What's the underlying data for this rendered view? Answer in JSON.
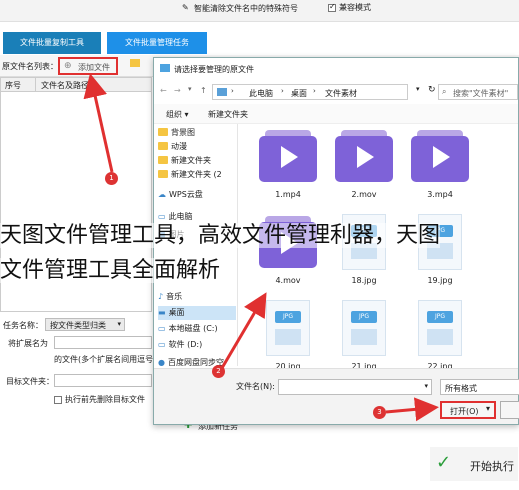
{
  "app": {
    "top_hint": "智能清除文件名中的特殊符号",
    "compat_label": "兼容模式",
    "tabs": [
      "文件批量复制工具",
      "文件批量管理任务"
    ],
    "file_list_label": "原文件名列表：",
    "add_file_button": "添加文件",
    "table_headers": [
      "序号",
      "文件名及路径"
    ],
    "task_name_label": "任务名称：",
    "task_name_value": "按文件类型归类",
    "ext_label": "将扩展名为",
    "ext_hint": "的文件(多个扩展名间用逗号",
    "target_folder_label": "目标文件夹：",
    "clear_before_label": "执行前先删除目标文件",
    "add_task_button": "添加新任务",
    "start_button": "开始执行"
  },
  "dialog": {
    "title": "请选择要管理的原文件",
    "breadcrumb": [
      "此电脑",
      "桌面",
      "文件素材"
    ],
    "search_placeholder": "搜索\"文件素材\"",
    "organize_label": "组织",
    "new_folder_label": "新建文件夹",
    "nav_items": [
      {
        "label": "背景图",
        "icon": "folder-icon"
      },
      {
        "label": "动漫",
        "icon": "folder-icon"
      },
      {
        "label": "新建文件夹",
        "icon": "folder-icon"
      },
      {
        "label": "新建文件夹 (2",
        "icon": "folder-icon"
      },
      {
        "label": "WPS云盘",
        "icon": "cloud-icon"
      },
      {
        "label": "此电脑",
        "icon": "computer-icon"
      },
      {
        "label": "图片",
        "icon": "image-icon"
      },
      {
        "label": "音乐",
        "icon": "music-icon"
      },
      {
        "label": "桌面",
        "icon": "desktop-icon"
      },
      {
        "label": "本地磁盘 (C:)",
        "icon": "drive-icon"
      },
      {
        "label": "软件 (D:)",
        "icon": "drive-icon"
      },
      {
        "label": "百度网盘同步空",
        "icon": "baidu-icon"
      }
    ],
    "files": [
      {
        "name": "1.mp4",
        "type": "video"
      },
      {
        "name": "2.mov",
        "type": "video"
      },
      {
        "name": "3.mp4",
        "type": "video"
      },
      {
        "name": "4.mov",
        "type": "video"
      },
      {
        "name": "18.jpg",
        "type": "image"
      },
      {
        "name": "19.jpg",
        "type": "image"
      },
      {
        "name": "20.jpg",
        "type": "image"
      },
      {
        "name": "21.jpg",
        "type": "image"
      },
      {
        "name": "22.jpg",
        "type": "image"
      }
    ],
    "filename_label": "文件名(N):",
    "filetype_value": "所有格式",
    "open_button": "打开(O)",
    "jpg_tag": "JPG"
  },
  "annotations": [
    "1",
    "2",
    "3"
  ],
  "headline": {
    "line1": "天图文件管理工具，高效文件管理利器，天图",
    "line2": "文件管理工具全面解析"
  },
  "colors": {
    "tab_blue": "#1e90e8",
    "tab_teal": "#1a7fb8",
    "accent_red": "#e03030",
    "video_purple": "#7e62d8",
    "folder_yellow": "#f5c542"
  }
}
